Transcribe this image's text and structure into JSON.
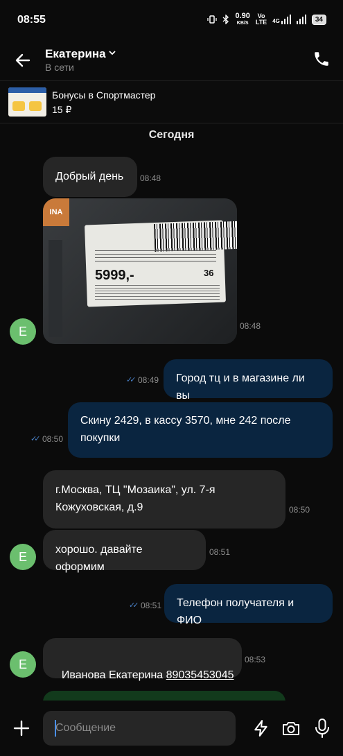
{
  "status_bar": {
    "time": "08:55",
    "speed_value": "0.90",
    "speed_unit": "KB/S",
    "network_a": "Vo",
    "network_b": "LTE",
    "network_4g": "4G",
    "battery": "34"
  },
  "header": {
    "contact_name": "Екатерина",
    "contact_status": "В сети"
  },
  "promo": {
    "title": "Бонусы в Спортмастер",
    "amount": "15 ₽"
  },
  "date_separator": "Сегодня",
  "messages": [
    {
      "text": "Добрый день",
      "time": "08:48"
    },
    {
      "photo_price": "5999,-",
      "photo_size": "36",
      "photo_badge": "INA",
      "time": "08:48"
    },
    {
      "text": "Город тц и в магазине ли вы",
      "time": "08:49"
    },
    {
      "text_line1": "Скину 2429, в кассу 3570, мне 242 после",
      "text_line2": "покупки",
      "time": "08:50"
    },
    {
      "text_line1": "г.Москва, ТЦ \"Мозаика\", ул. 7-я",
      "text_line2": "Кожуховская, д.9",
      "time": "08:50"
    },
    {
      "text": "хорошо. давайте оформим",
      "time": "08:51"
    },
    {
      "text": "Телефон получателя и ФИО",
      "time": "08:51"
    },
    {
      "text_name": "Иванова Екатерина ",
      "text_phone": "89035453045",
      "time": "08:53"
    }
  ],
  "avatar_letter": "Е",
  "composer": {
    "placeholder": "Сообщение"
  },
  "colors": {
    "incoming_bubble": "#262626",
    "outgoing_bubble": "#0a2540",
    "avatar": "#6bbf6e",
    "read_ticks": "#4a82c9"
  }
}
